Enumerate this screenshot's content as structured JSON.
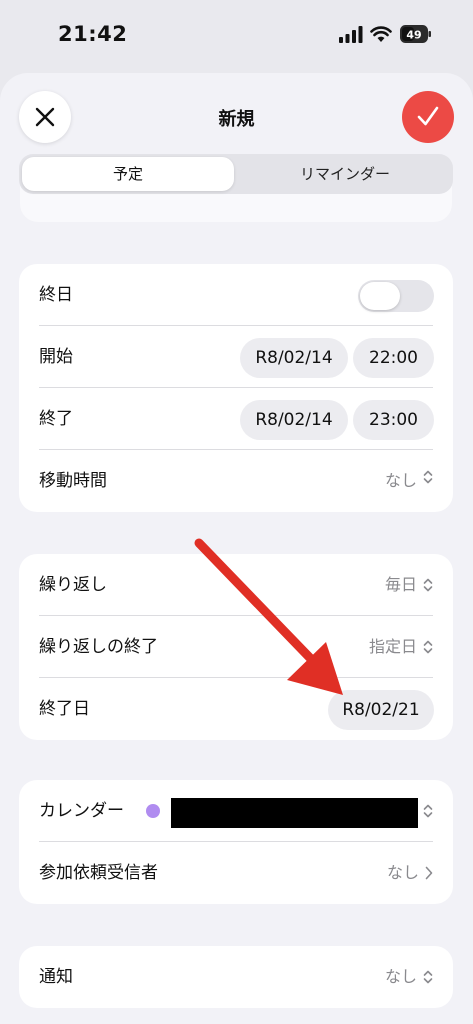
{
  "status_bar": {
    "time": "21:42",
    "battery": "49"
  },
  "header": {
    "title": "新規"
  },
  "segment": {
    "event": "予定",
    "reminder": "リマインダー"
  },
  "card1": {
    "allday_label": "終日",
    "start_label": "開始",
    "start_date": "R8/02/14",
    "start_time": "22:00",
    "end_label": "終了",
    "end_date": "R8/02/14",
    "end_time": "23:00",
    "travel_label": "移動時間",
    "travel_value": "なし"
  },
  "card2": {
    "repeat_label": "繰り返し",
    "repeat_value": "毎日",
    "repeat_end_label": "繰り返しの終了",
    "repeat_end_value": "指定日",
    "end_date_label": "終了日",
    "end_date_value": "R8/02/21"
  },
  "card3": {
    "calendar_label": "カレンダー",
    "invitees_label": "参加依頼受信者",
    "invitees_value": "なし"
  },
  "card4": {
    "alert_label": "通知",
    "alert_value": "なし"
  },
  "colors": {
    "accent": "#ec4a45",
    "calendar_dot": "#b08cf0",
    "arrow": "#e02f25"
  }
}
